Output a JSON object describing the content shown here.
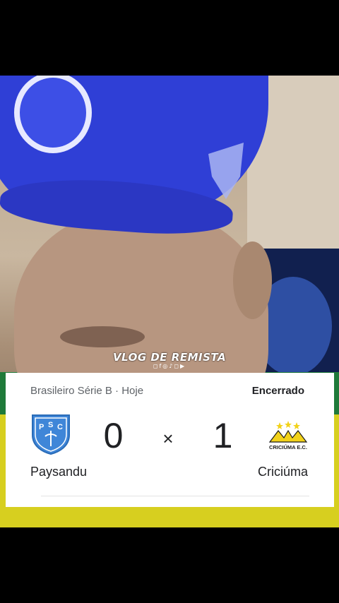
{
  "overlay": {
    "watermark": "VLOG DE REMISTA",
    "social_icons": "◻f◎♪◻▶"
  },
  "match_card": {
    "league": "Brasileiro Série B · Hoje",
    "status": "Encerrado",
    "home_team": "Paysandu",
    "away_team": "Criciúma",
    "home_score": "0",
    "away_score": "1",
    "separator": "×",
    "home_crest_letters": "PSC",
    "away_crest_text": "CRICIÚMA E.C.",
    "colors": {
      "home_crest": "#3f86d8",
      "away_crest": "#f2d21a"
    }
  }
}
